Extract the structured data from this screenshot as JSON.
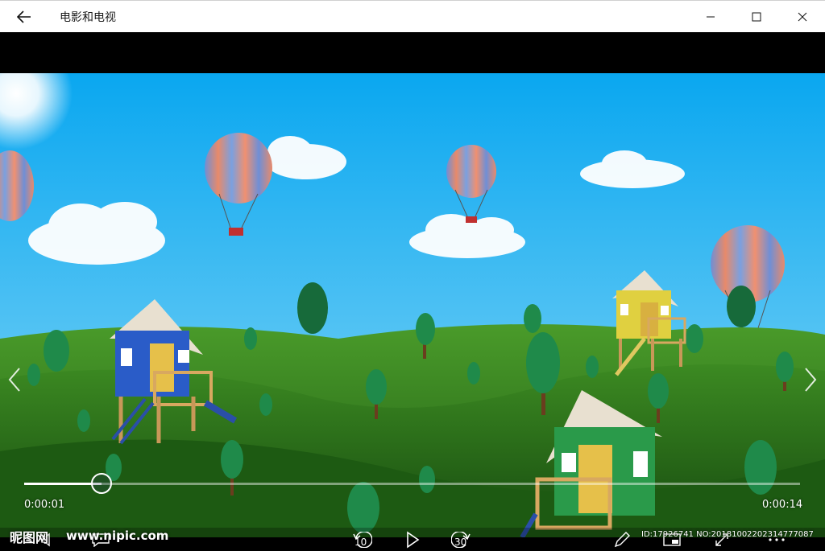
{
  "titlebar": {
    "app_title": "电影和电视",
    "back_icon": "arrow-left-icon",
    "minimize_icon": "minimize-icon",
    "maximize_icon": "maximize-icon",
    "close_icon": "close-icon"
  },
  "player": {
    "position_fraction": 0.1,
    "elapsed": "0:00:01",
    "remaining": "0:00:14",
    "skip_back_seconds": "10",
    "skip_forward_seconds": "30"
  },
  "watermark": {
    "logo_text": "昵图网",
    "site_text": "www.nipic.com",
    "id_text": "ID:17926741 NO:20181002202314777087"
  },
  "colors": {
    "sky_top": "#0aa7f0",
    "sky_bottom": "#7fd4f5",
    "hill_green": "#2e7d1f",
    "accent_white": "#ffffff"
  }
}
